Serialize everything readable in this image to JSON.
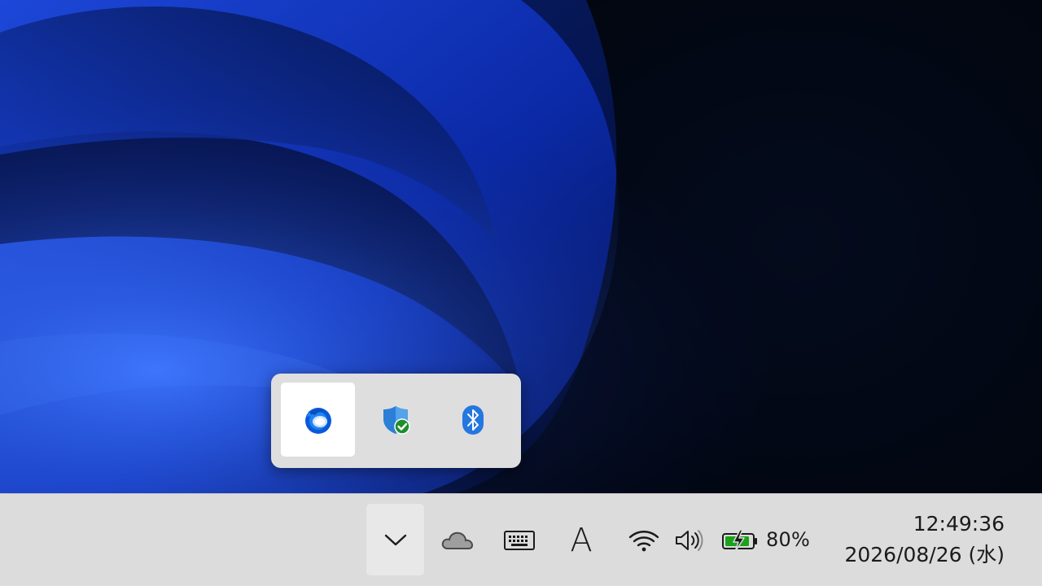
{
  "flyout": {
    "items": [
      {
        "icon": "thunderbird-icon",
        "selected": true
      },
      {
        "icon": "windows-security-shield-icon",
        "selected": false
      },
      {
        "icon": "bluetooth-icon",
        "selected": false
      }
    ]
  },
  "tray": {
    "icons": [
      "chevron-up-icon",
      "onedrive-cloud-icon",
      "touch-keyboard-icon",
      "ime-mode-icon",
      "wifi-icon",
      "volume-icon",
      "battery-charging-icon"
    ],
    "ime_mode_label": "A",
    "battery_percent": "80%"
  },
  "clock": {
    "time": "12:49:36",
    "date": "2026/08/26 (水)"
  },
  "colors": {
    "taskbar": "#dcdcdc",
    "flyout": "#dedede",
    "battery_green": "#1aa31a",
    "accent_blue": "#0a64d2"
  }
}
